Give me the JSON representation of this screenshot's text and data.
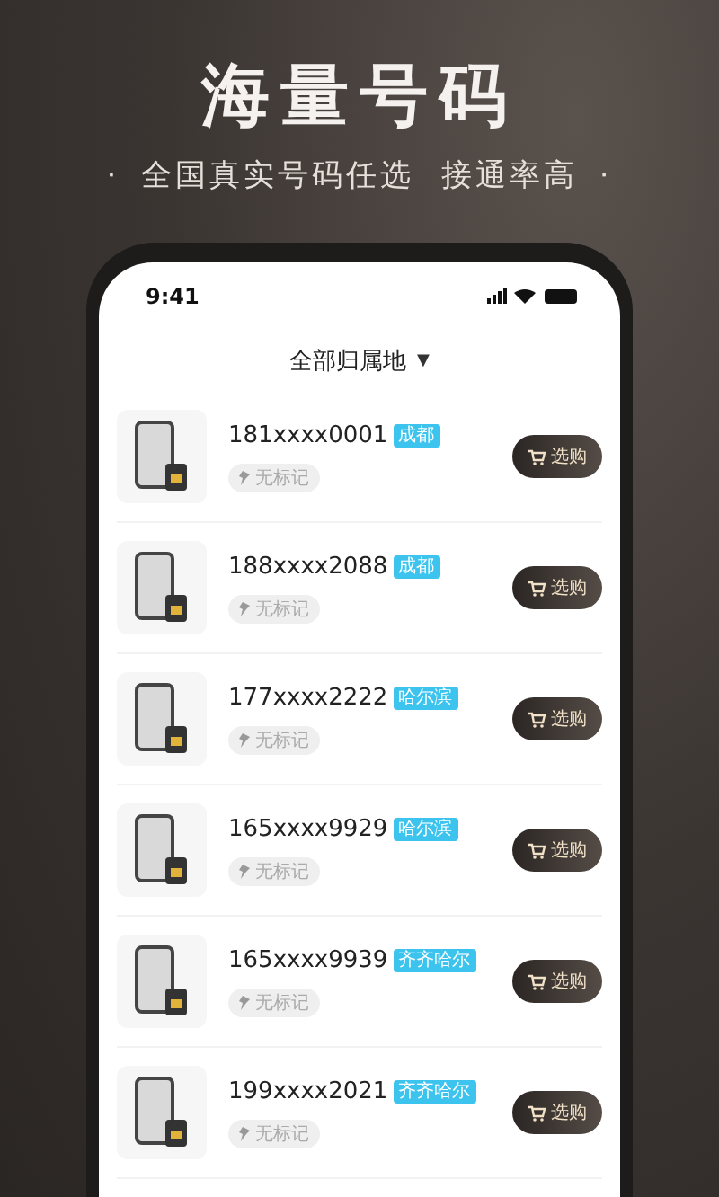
{
  "headline": "海量号码",
  "tagline": {
    "dot_left": "·",
    "text": "全国真实号码任选  接通率高",
    "dot_right": "·"
  },
  "status_bar": {
    "time": "9:41"
  },
  "region_filter": {
    "label": "全部归属地",
    "caret": "▼"
  },
  "numbers": [
    {
      "number": "181xxxx0001",
      "region": "成都",
      "note": "无标记",
      "action": "选购"
    },
    {
      "number": "188xxxx2088",
      "region": "成都",
      "note": "无标记",
      "action": "选购"
    },
    {
      "number": "177xxxx2222",
      "region": "哈尔滨",
      "note": "无标记",
      "action": "选购"
    },
    {
      "number": "165xxxx9929",
      "region": "哈尔滨",
      "note": "无标记",
      "action": "选购"
    },
    {
      "number": "165xxxx9939",
      "region": "齐齐哈尔",
      "note": "无标记",
      "action": "选购"
    },
    {
      "number": "199xxxx2021",
      "region": "齐齐哈尔",
      "note": "无标记",
      "action": "选购"
    }
  ]
}
